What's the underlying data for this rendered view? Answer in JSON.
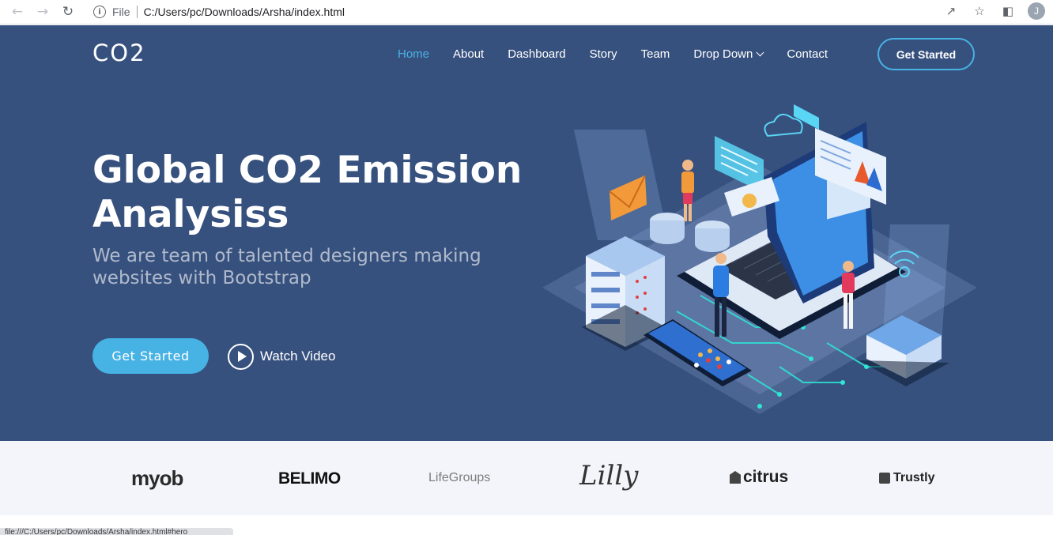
{
  "browser": {
    "back_icon": "arrow-left-icon",
    "forward_icon": "arrow-right-icon",
    "reload_icon": "reload-icon",
    "file_label": "File",
    "url": "C:/Users/pc/Downloads/Arsha/index.html",
    "avatar_letter": "J",
    "status_text": "file:///C:/Users/pc/Downloads/Arsha/index.html#hero"
  },
  "header": {
    "logo": "CO2",
    "nav": [
      "Home",
      "About",
      "Dashboard",
      "Story",
      "Team",
      "Drop Down",
      "Contact"
    ],
    "cta": "Get Started"
  },
  "hero": {
    "title": "Global CO2 Emission Analysiss",
    "subtitle": "We are team of talented designers making websites with Bootstrap",
    "primary_button": "Get Started",
    "watch_video": "Watch Video"
  },
  "clients": [
    "myob",
    "BELIMO",
    "LifeGroups",
    "Lilly",
    "citrus",
    "Trustly"
  ],
  "colors": {
    "hero_bg": "#37517e",
    "accent": "#47b2e4",
    "clients_bg": "#f3f5fa"
  }
}
